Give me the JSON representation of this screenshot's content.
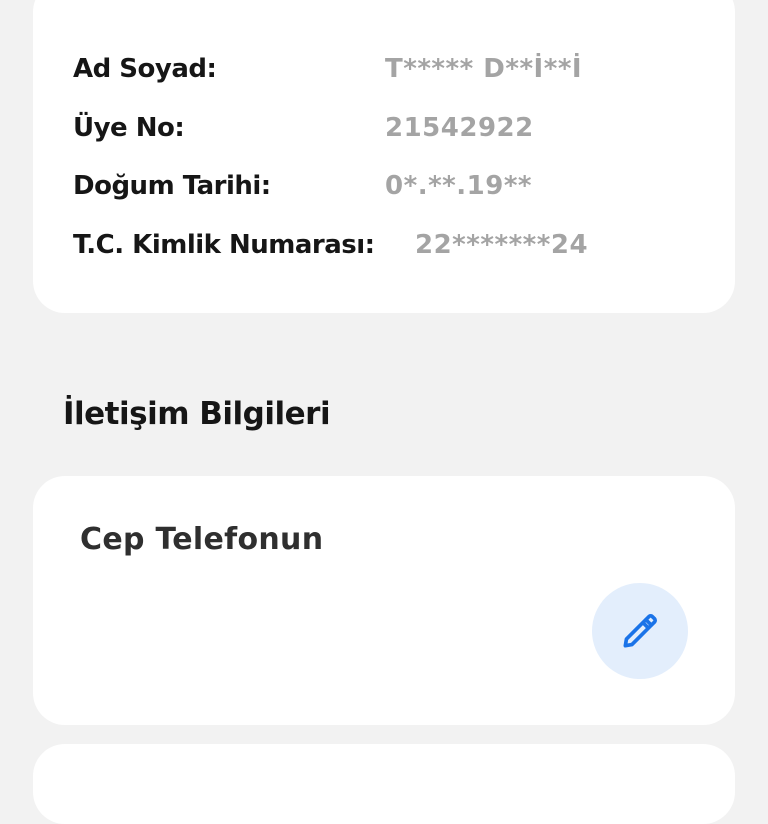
{
  "personal_info": {
    "rows": [
      {
        "label": "Ad Soyad:",
        "value": "T***** D**İ**İ"
      },
      {
        "label": "Üye No:",
        "value": "21542922"
      },
      {
        "label": "Doğum Tarihi:",
        "value": "0*.**.19**"
      },
      {
        "label": "T.C. Kimlik Numarası:",
        "value": "22*******24"
      }
    ]
  },
  "contact_section": {
    "title": "İletişim Bilgileri",
    "phone_label": "Cep Telefonun",
    "edit_icon": "pencil-icon"
  },
  "colors": {
    "background": "#f2f2f2",
    "card": "#ffffff",
    "label_text": "#161616",
    "masked_value": "#a4a4a4",
    "edit_button_bg": "#e3eefc",
    "accent_blue": "#1a73e8"
  }
}
